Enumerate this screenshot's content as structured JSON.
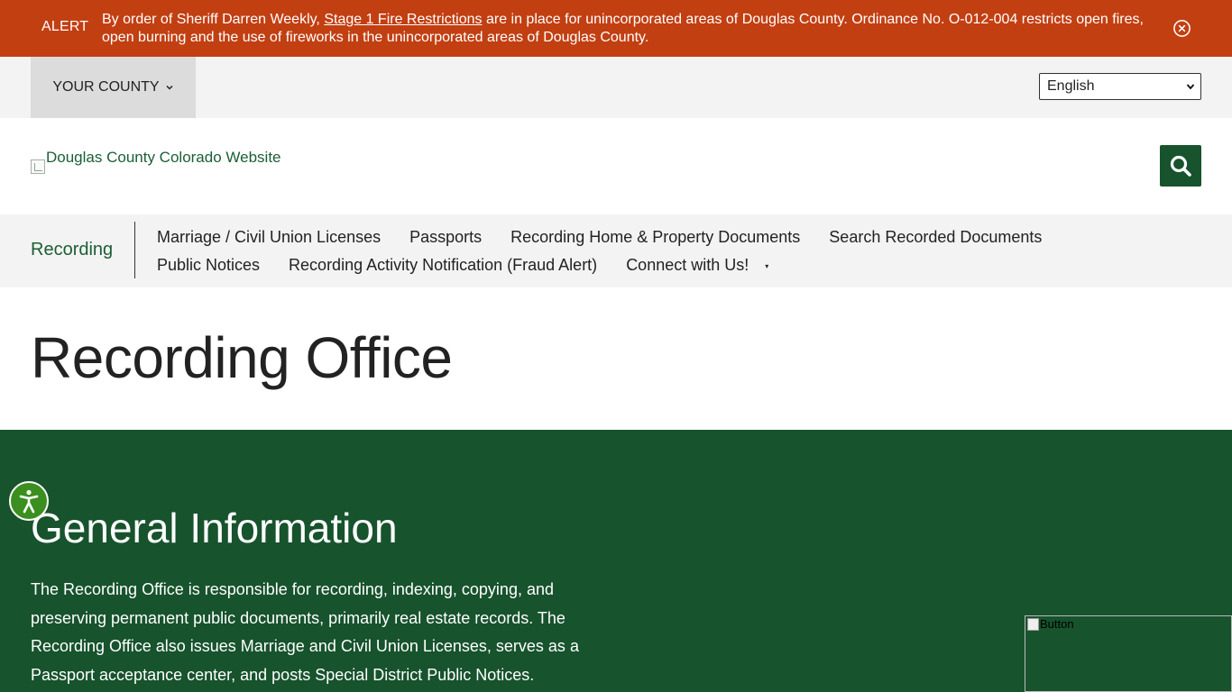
{
  "alert": {
    "label": "ALERT",
    "text_before": "By order of Sheriff Darren Weekly, ",
    "link_text": "Stage 1 Fire Restrictions",
    "text_after": " are in place for unincorporated areas of Douglas County. Ordinance No. O-012-004 restricts open fires, open burning and the use of fireworks in the unincorporated areas of Douglas County.",
    "close_icon": "close-circle-icon"
  },
  "utility": {
    "county_label": "YOUR COUNTY",
    "language_value": "English"
  },
  "header": {
    "logo_alt": "Douglas County Colorado Website",
    "search_icon": "search-icon"
  },
  "subnav": {
    "title": "Recording",
    "row1": [
      "Marriage / Civil Union Licenses",
      "Passports",
      "Recording Home & Property Documents",
      "Search Recorded Documents"
    ],
    "row2": [
      "Public Notices",
      "Recording Activity Notification (Fraud Alert)",
      "Connect with Us!"
    ],
    "caret": "▾"
  },
  "page": {
    "title": "Recording Office"
  },
  "general": {
    "title": "General Information",
    "body": "The Recording Office is responsible for recording, indexing, copying, and preserving permanent public documents, primarily real estate records. The Recording Office also issues Marriage and Civil Union Licenses, serves as a Passport acceptance center, and posts Special District Public Notices."
  },
  "widgets": {
    "chat_alt": "Button"
  },
  "colors": {
    "alert_bg": "#c23f12",
    "brand_green": "#17532d",
    "accessibility_green": "#3b8f1e"
  }
}
